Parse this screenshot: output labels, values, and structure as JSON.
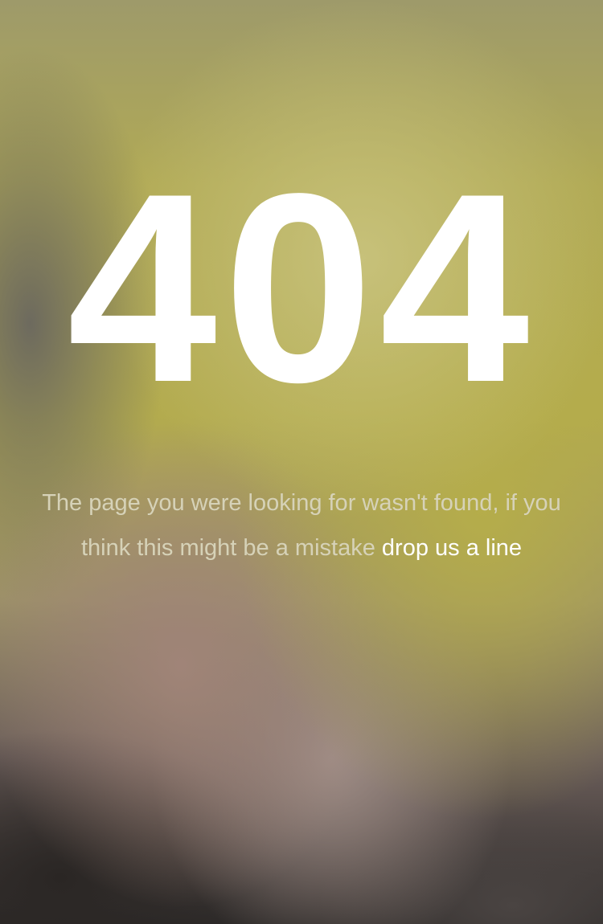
{
  "error": {
    "code": "404",
    "message": "The page you were looking for wasn't found, if you think this might be a mistake",
    "link_label": "drop us a line"
  }
}
